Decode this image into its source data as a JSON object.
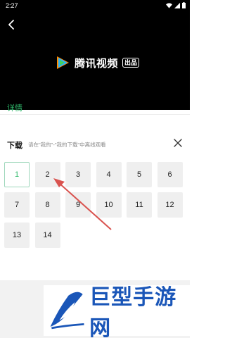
{
  "status_bar": {
    "time": "2:27"
  },
  "player": {
    "brand_name": "腾讯视频",
    "brand_badge": "出品"
  },
  "sheet": {
    "tab_label": "详情",
    "download_title": "下载",
    "download_hint": "请在\"我的\"-\"我的下载\"中离线观看"
  },
  "episodes": [
    "1",
    "2",
    "3",
    "4",
    "5",
    "6",
    "7",
    "8",
    "9",
    "10",
    "11",
    "12",
    "13",
    "14"
  ],
  "selected_episode": "1",
  "watermark": {
    "text": "巨型手游网"
  },
  "colors": {
    "accent": "#2fba6b",
    "arrow": "#d9534f",
    "watermark": "#1a56b8"
  }
}
